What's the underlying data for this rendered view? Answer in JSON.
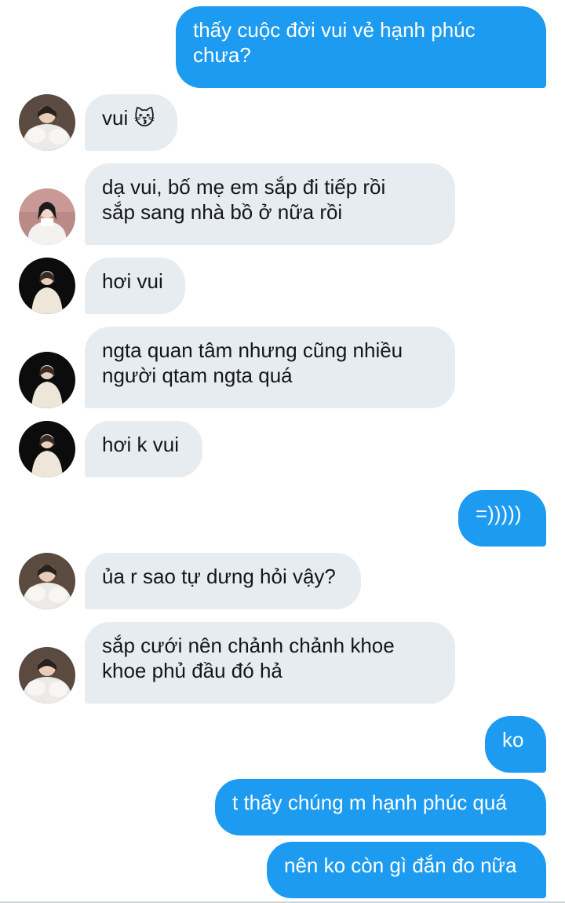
{
  "messages": [
    {
      "side": "out",
      "text": "thấy cuộc đời vui vẻ hạnh phúc",
      "text2": "chưa?"
    },
    {
      "side": "in",
      "text": "vui",
      "emoji": "😽",
      "avatar": "white-fluffy-coat"
    },
    {
      "side": "in",
      "text": "dạ vui, bố mẹ em sắp đi tiếp rồi",
      "text2": "sắp sang nhà bồ ở nữa rồi",
      "avatar": "pink-background"
    },
    {
      "side": "in",
      "text": "hơi vui",
      "avatar": "dark-night"
    },
    {
      "side": "in",
      "text": "ngta quan tâm nhưng cũng nhiều",
      "text2": "người qtam ngta quá",
      "avatar": "dark-night"
    },
    {
      "side": "in",
      "text": "hơi k vui",
      "avatar": "dark-night"
    },
    {
      "side": "out",
      "text": "=)))))"
    },
    {
      "side": "in",
      "text": "ủa r sao tự dưng hỏi vậy?",
      "avatar": "white-fluffy-coat"
    },
    {
      "side": "in",
      "text": "sắp cưới nên chảnh chảnh khoe",
      "text2": "khoe phủ đầu đó hả",
      "avatar": "white-fluffy-coat"
    },
    {
      "side": "out",
      "text": "ko"
    },
    {
      "side": "out",
      "text": "t thấy chúng m hạnh phúc quá"
    },
    {
      "side": "out",
      "text": "nên ko còn gì đắn đo nữa"
    }
  ],
  "colors": {
    "outgoing_bubble": "#1d9bf0",
    "incoming_bubble": "#e6ecf0"
  }
}
